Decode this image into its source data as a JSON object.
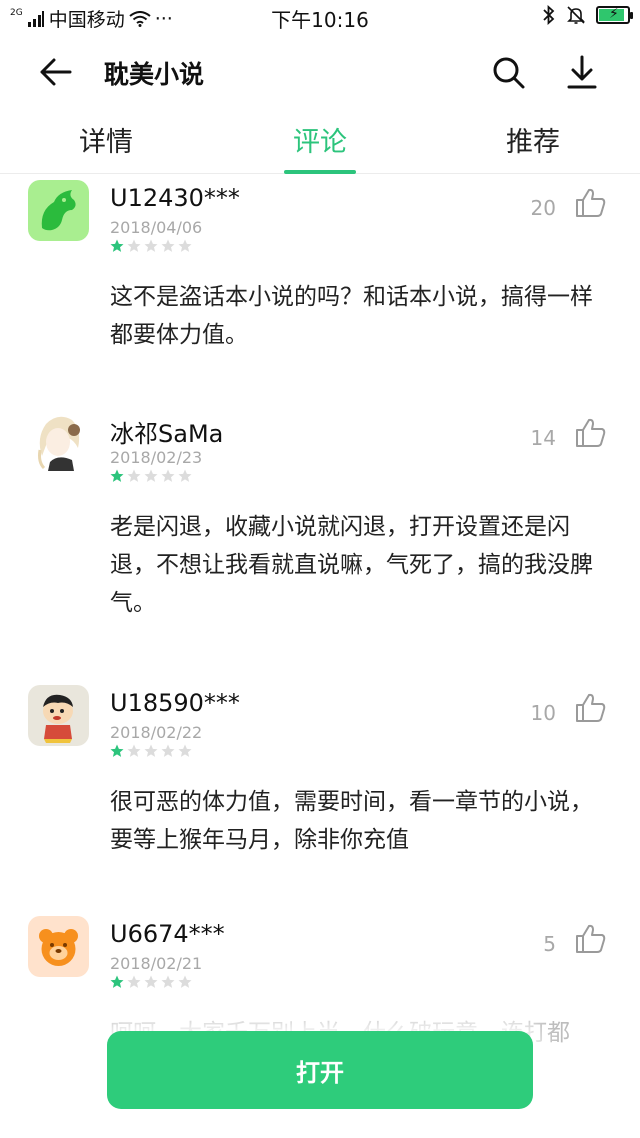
{
  "status_bar": {
    "network_tag": "2G",
    "carrier": "中国移动",
    "more_dots": "···",
    "time": "下午10:16",
    "battery_level": 0.9
  },
  "header": {
    "title": "耽美小说",
    "back_icon": "arrow-left-icon",
    "search_icon": "search-icon",
    "download_icon": "download-icon"
  },
  "tabs": [
    {
      "label": "详情",
      "active": false
    },
    {
      "label": "评论",
      "active": true
    },
    {
      "label": "推荐",
      "active": false
    }
  ],
  "colors": {
    "accent": "#2cc47c",
    "star_filled": "#2cc47c",
    "star_empty": "#dcdcdc"
  },
  "comments": [
    {
      "user": "U12430***",
      "date": "2018/04/06",
      "rating": 1,
      "likes": "20",
      "text": "这不是盗话本小说的吗？和话本小说，搞得一样都要体力值。",
      "avatar": "green-horse-app-icon"
    },
    {
      "user": "冰祁SaMa",
      "date": "2018/02/23",
      "rating": 1,
      "likes": "14",
      "text": "老是闪退，收藏小说就闪退，打开设置还是闪退，不想让我看就直说嘛，气死了，搞的我没脾气。",
      "avatar": "anime-girl-avatar"
    },
    {
      "user": "U18590***",
      "date": "2018/02/22",
      "rating": 1,
      "likes": "10",
      "text": "很可恶的体力值，需要时间，看一章节的小说，要等上猴年马月，除非你充值",
      "avatar": "cartoon-boy-avatar"
    },
    {
      "user": "U6674***",
      "date": "2018/02/21",
      "rating": 1,
      "likes": "5",
      "text": "呵呵，大家千万别上当，什么破玩意，连打都",
      "avatar": "orange-bear-app-icon"
    }
  ],
  "open_button": {
    "label": "打开"
  }
}
